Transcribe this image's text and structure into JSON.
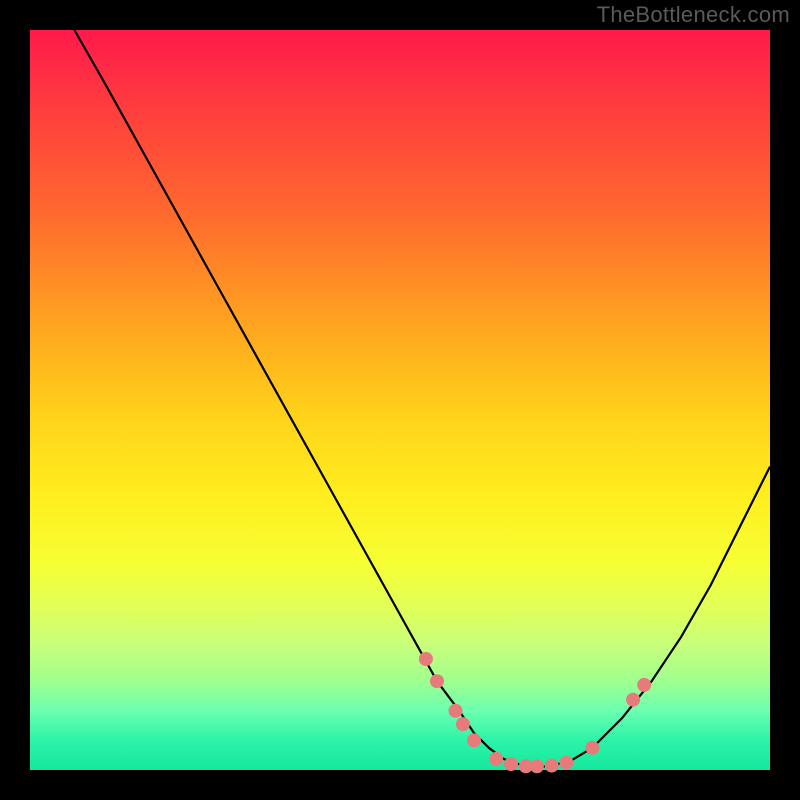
{
  "watermark": "TheBottleneck.com",
  "chart_data": {
    "type": "line",
    "title": "",
    "xlabel": "",
    "ylabel": "",
    "xlim": [
      0,
      100
    ],
    "ylim": [
      0,
      100
    ],
    "series": [
      {
        "name": "curve",
        "color": "#000000",
        "x": [
          6,
          10,
          15,
          20,
          25,
          30,
          35,
          40,
          45,
          50,
          55,
          58,
          60,
          62,
          64,
          66,
          68,
          70,
          73,
          76,
          80,
          84,
          88,
          92,
          96,
          100
        ],
        "y": [
          100,
          93,
          84,
          75,
          66,
          57,
          48,
          39,
          30,
          21,
          12,
          8,
          5,
          3,
          1.5,
          0.8,
          0.4,
          0.5,
          1.2,
          3,
          7,
          12,
          18,
          25,
          33,
          41
        ]
      }
    ],
    "markers": {
      "name": "dots",
      "color": "#e77b7b",
      "radius": 7,
      "points": [
        {
          "x": 53.5,
          "y": 15
        },
        {
          "x": 55.0,
          "y": 12
        },
        {
          "x": 57.5,
          "y": 8
        },
        {
          "x": 58.5,
          "y": 6.2
        },
        {
          "x": 60.0,
          "y": 4
        },
        {
          "x": 63.0,
          "y": 1.5
        },
        {
          "x": 65.0,
          "y": 0.8
        },
        {
          "x": 67.0,
          "y": 0.5
        },
        {
          "x": 68.5,
          "y": 0.5
        },
        {
          "x": 70.5,
          "y": 0.6
        },
        {
          "x": 72.5,
          "y": 1.0
        },
        {
          "x": 76.0,
          "y": 3.0
        },
        {
          "x": 81.5,
          "y": 9.5
        },
        {
          "x": 83.0,
          "y": 11.5
        }
      ]
    },
    "gradient_stops": [
      {
        "offset": 0,
        "color": "#ff1a4b"
      },
      {
        "offset": 25,
        "color": "#ff6a2e"
      },
      {
        "offset": 52,
        "color": "#ffd21a"
      },
      {
        "offset": 78,
        "color": "#e1ff58"
      },
      {
        "offset": 100,
        "color": "#15e89e"
      }
    ]
  }
}
